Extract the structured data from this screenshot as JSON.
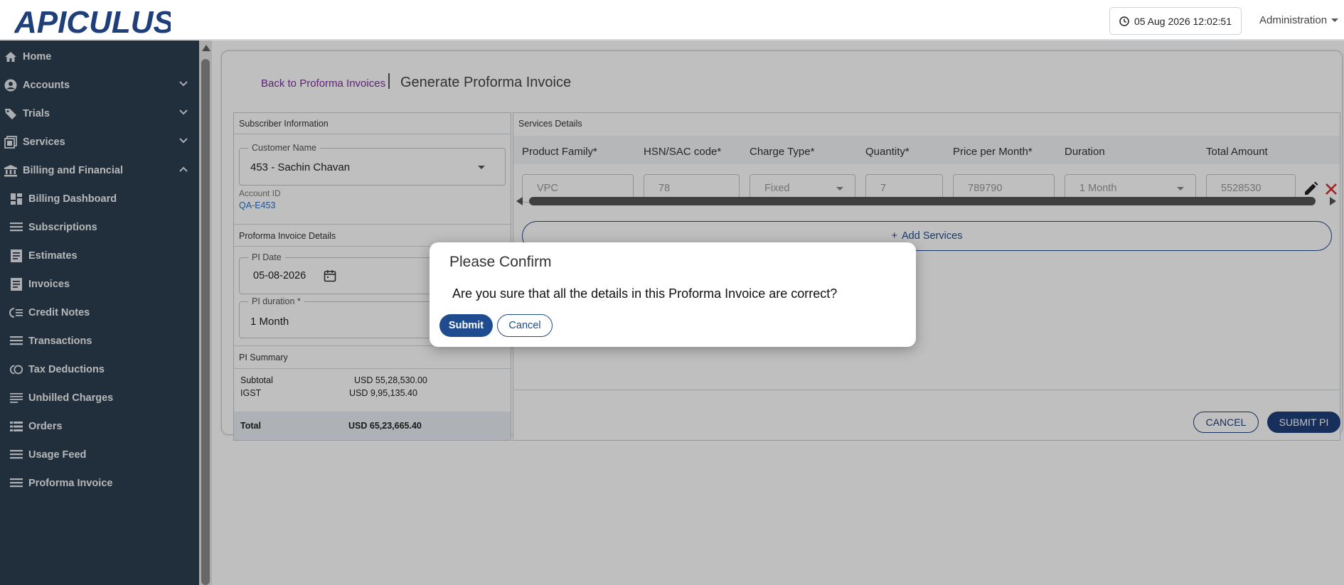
{
  "header": {
    "logo_text": "APICULUS",
    "datetime": "05 Aug 2026 12:02:51",
    "user_menu": "Administration"
  },
  "sidebar": {
    "items": [
      {
        "label": "Home",
        "icon": "home-icon"
      },
      {
        "label": "Accounts",
        "icon": "user-circle-icon",
        "expandable": true,
        "expanded": false
      },
      {
        "label": "Trials",
        "icon": "tag-icon",
        "expandable": true,
        "expanded": false
      },
      {
        "label": "Services",
        "icon": "layers-icon",
        "expandable": true,
        "expanded": false
      },
      {
        "label": "Billing and Financial",
        "icon": "bank-icon",
        "expandable": true,
        "expanded": true
      },
      {
        "label": "Billing Dashboard",
        "icon": "dashboard-icon"
      },
      {
        "label": "Subscriptions",
        "icon": "list-icon"
      },
      {
        "label": "Estimates",
        "icon": "document-icon"
      },
      {
        "label": "Invoices",
        "icon": "document-icon"
      },
      {
        "label": "Credit Notes",
        "icon": "credit-notes-icon"
      },
      {
        "label": "Transactions",
        "icon": "list-icon"
      },
      {
        "label": "Tax Deductions",
        "icon": "tax-icon"
      },
      {
        "label": "Unbilled Charges",
        "icon": "lines-icon"
      },
      {
        "label": "Orders",
        "icon": "table-icon"
      },
      {
        "label": "Usage Feed",
        "icon": "list-icon"
      },
      {
        "label": "Proforma Invoice",
        "icon": "list-icon"
      }
    ]
  },
  "page": {
    "back_link": "Back to Proforma Invoices",
    "title": "Generate Proforma Invoice"
  },
  "subscriber": {
    "heading": "Subscriber Information",
    "customer_label": "Customer Name",
    "customer_value": "453 - Sachin Chavan",
    "account_id_label": "Account ID",
    "account_id_value": "QA-E453"
  },
  "pi_details": {
    "heading": "Proforma Invoice Details",
    "date_label": "PI Date",
    "date_value": "05-08-2026",
    "duration_label": "PI duration *",
    "duration_value": "1 Month"
  },
  "summary": {
    "heading": "PI Summary",
    "subtotal_label": "Subtotal",
    "subtotal_value": "USD 55,28,530.00",
    "igst_label": "IGST",
    "igst_value": "USD 9,95,135.40",
    "total_label": "Total",
    "total_value": "USD 65,23,665.40"
  },
  "services": {
    "heading": "Services Details",
    "columns": [
      "Product Family*",
      "HSN/SAC code*",
      "Charge Type*",
      "Quantity*",
      "Price per Month*",
      "Duration",
      "Total Amount"
    ],
    "row": {
      "product_family": "VPC",
      "hsn_code": "78",
      "charge_type": "Fixed",
      "quantity": "7",
      "price": "789790",
      "duration": "1 Month",
      "total": "5528530"
    },
    "add_label": "Add Services",
    "cancel_label": "CANCEL",
    "submit_label": "SUBMIT PI"
  },
  "modal": {
    "title": "Please Confirm",
    "message": "Are you sure that all the details in this Proforma Invoice are correct?",
    "submit_label": "Submit",
    "cancel_label": "Cancel"
  },
  "colors": {
    "sidebar_bg": "#2c3e50",
    "brand_blue": "#1f4b8f",
    "link_purple": "#7b2e9a",
    "delete_red": "#d32f2f"
  }
}
